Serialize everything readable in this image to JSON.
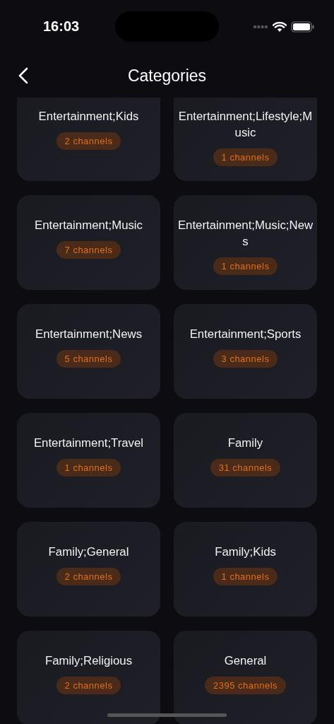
{
  "status_bar": {
    "time": "16:03"
  },
  "nav": {
    "title": "Categories"
  },
  "categories": [
    {
      "name": "Entertainment;Kids",
      "count": "2 channels"
    },
    {
      "name": "Entertainment;Lifestyle;Music",
      "count": "1 channels"
    },
    {
      "name": "Entertainment;Music",
      "count": "7 channels"
    },
    {
      "name": "Entertainment;Music;News",
      "count": "1 channels"
    },
    {
      "name": "Entertainment;News",
      "count": "5 channels"
    },
    {
      "name": "Entertainment;Sports",
      "count": "3 channels"
    },
    {
      "name": "Entertainment;Travel",
      "count": "1 channels"
    },
    {
      "name": "Family",
      "count": "31 channels"
    },
    {
      "name": "Family;General",
      "count": "2 channels"
    },
    {
      "name": "Family;Kids",
      "count": "1 channels"
    },
    {
      "name": "Family;Religious",
      "count": "2 channels"
    },
    {
      "name": "General",
      "count": "2395 channels"
    }
  ]
}
